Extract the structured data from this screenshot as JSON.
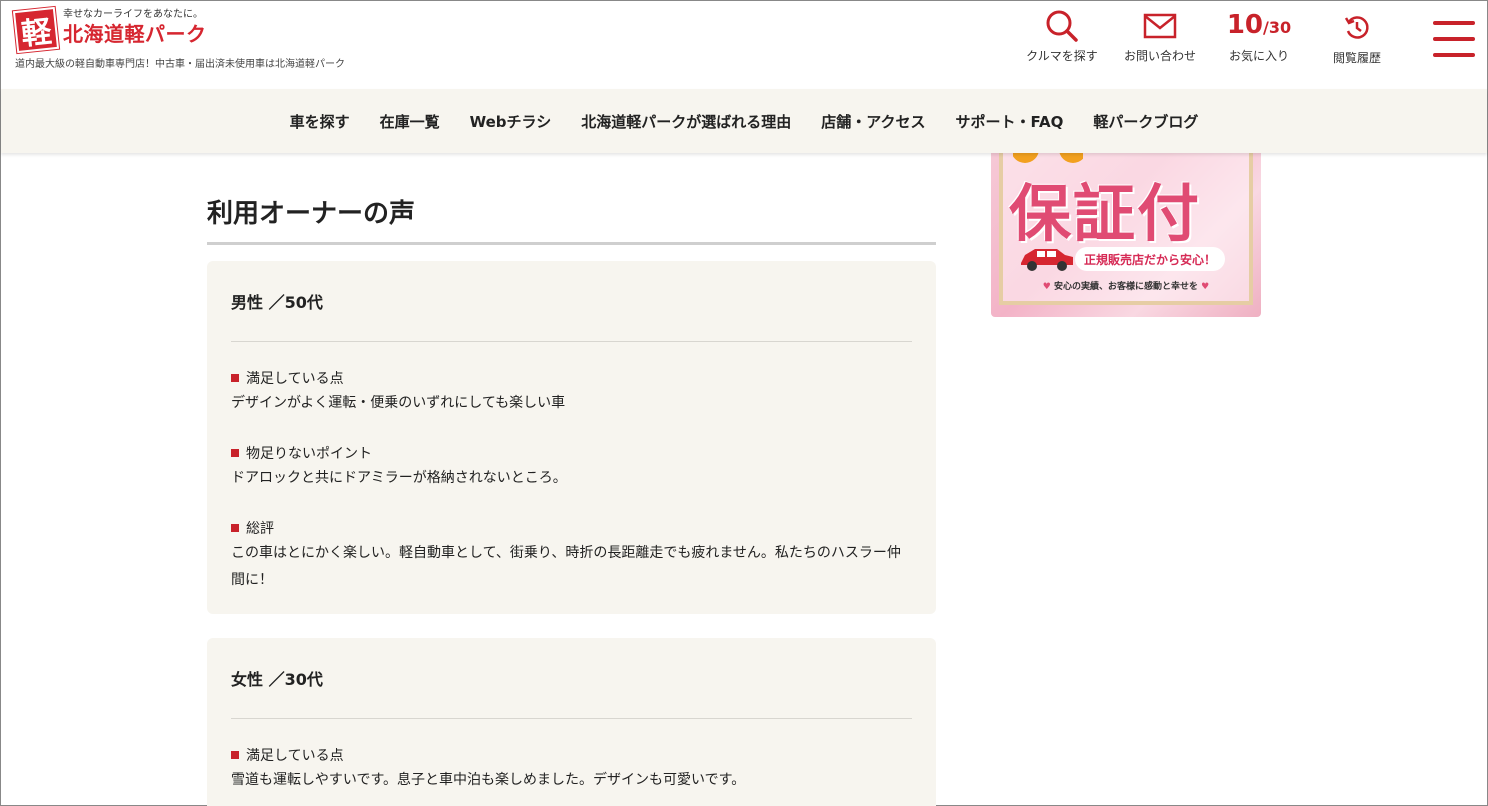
{
  "header": {
    "logo_mark": "軽",
    "logo_tagline": "幸せなカーライフをあなたに。",
    "logo_name": "北海道軽パーク",
    "logo_sub": "道内最大級の軽自動車専門店！中古車・届出済未使用車は北海道軽パーク",
    "nav": [
      {
        "label": "クルマを探す",
        "icon": "search-icon"
      },
      {
        "label": "お問い合わせ",
        "icon": "mail-icon"
      },
      {
        "label": "お気に入り",
        "count": "10",
        "max": "/30"
      },
      {
        "label": "閲覧履歴",
        "icon": "history-icon"
      }
    ],
    "accent": "#c8222a"
  },
  "navbar": {
    "items": [
      "車を探す",
      "在庫一覧",
      "Webチラシ",
      "北海道軽パークが選ばれる理由",
      "店舗・アクセス",
      "サポート・FAQ",
      "軽パークブログ"
    ]
  },
  "main": {
    "title": "利用オーナーの声",
    "reviews": [
      {
        "author": "男性 ／50代",
        "sections": [
          {
            "heading": "満足している点",
            "body": "デザインがよく運転・便乗のいずれにしても楽しい車"
          },
          {
            "heading": "物足りないポイント",
            "body": "ドアロックと共にドアミラーが格納されないところ。"
          },
          {
            "heading": "総評",
            "body": "この車はとにかく楽しい。軽自動車として、街乗り、時折の長距離走でも疲れません。私たちのハスラー仲間に！"
          }
        ]
      },
      {
        "author": "女性 ／30代",
        "sections": [
          {
            "heading": "満足している点",
            "body": "雪道も運転しやすいです。息子と車中泊も楽しめました。デザインも可愛いです。"
          }
        ]
      }
    ]
  },
  "banner": {
    "big_text": "保証付",
    "pill_text": "正規販売店だから安心！",
    "small_text": "安心の実績、お客様に感動と幸せを",
    "heart": "♥"
  }
}
